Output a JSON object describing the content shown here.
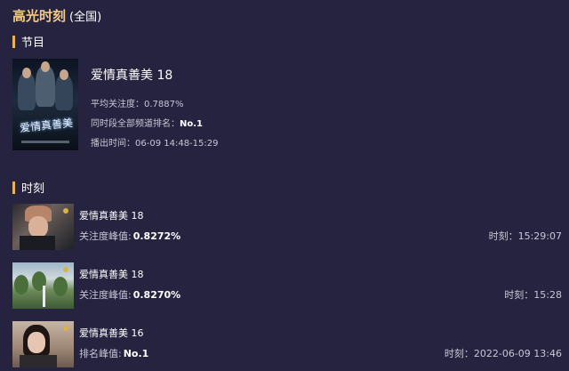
{
  "header": {
    "title": "高光时刻",
    "scope": "(全国)"
  },
  "program_section": {
    "title": "节目"
  },
  "program": {
    "name": "爱情真善美 18",
    "poster_text": "爱情真善美",
    "avg_attention_label": "平均关注度：",
    "avg_attention_value": "0.7887%",
    "rank_label": "同时段全部频道排名：",
    "rank_value": "No.1",
    "airtime_label": "播出时间：",
    "airtime_value": "06-09 14:48-15:29"
  },
  "moments_section": {
    "title": "时刻"
  },
  "moments": [
    {
      "name": "爱情真善美 18",
      "label": "关注度峰值:",
      "value": "0.8272%",
      "time": "时刻：15:29:07"
    },
    {
      "name": "爱情真善美 18",
      "label": "关注度峰值:",
      "value": "0.8270%",
      "time": "时刻：15:28"
    },
    {
      "name": "爱情真善美 16",
      "label": "排名峰值:",
      "value": "No.1",
      "time": "时刻：2022-06-09 13:46"
    }
  ],
  "colors": {
    "background": "#262340",
    "accent": "#f3c98b",
    "bar": "#e9b35a"
  }
}
